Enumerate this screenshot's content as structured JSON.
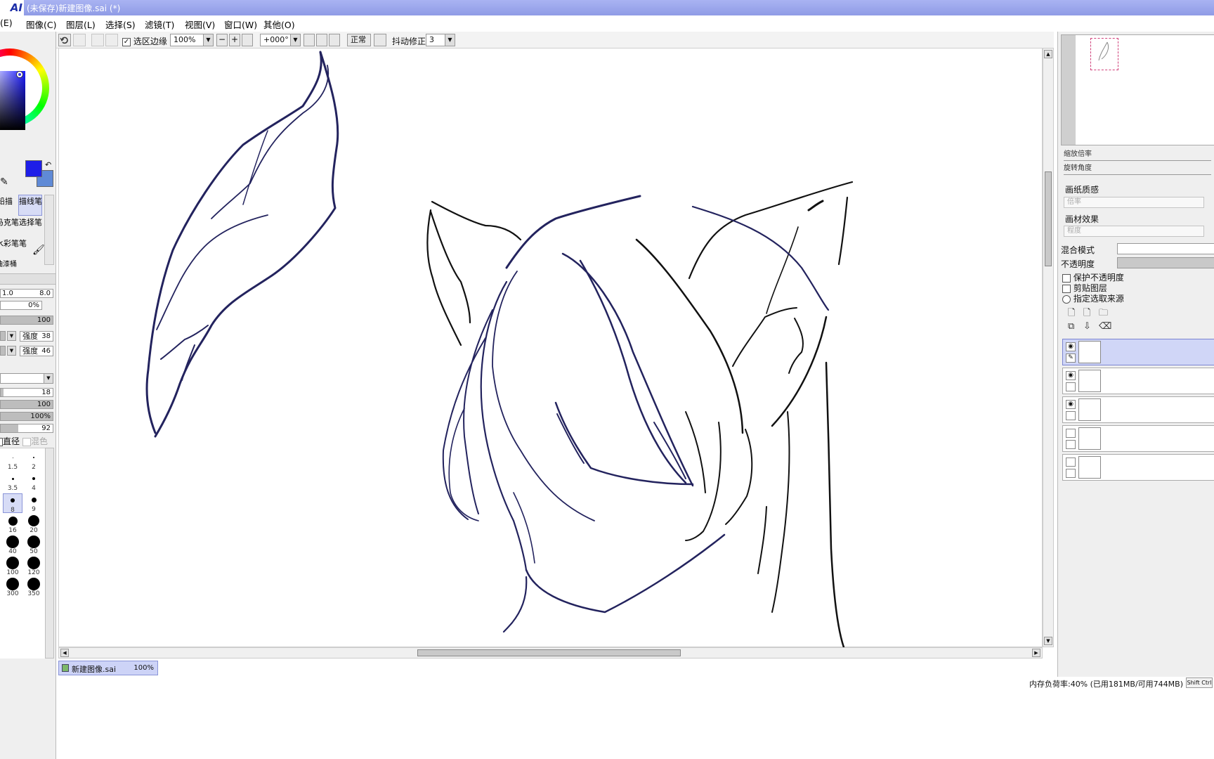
{
  "app": {
    "logo": "AI",
    "window_title": "(未保存)新建图像.sai (*)"
  },
  "menu": [
    {
      "label": "(E)"
    },
    {
      "label": "图像(C)"
    },
    {
      "label": "图层(L)"
    },
    {
      "label": "选择(S)"
    },
    {
      "label": "滤镜(T)"
    },
    {
      "label": "视图(V)"
    },
    {
      "label": "窗口(W)"
    },
    {
      "label": "其他(O)"
    }
  ],
  "toolbar": {
    "selection_edge_label": "选区边缘",
    "selection_edge_checked": true,
    "zoom_value": "100%",
    "rotation_value": "+000°",
    "blend_label": "正常",
    "stabilizer_label": "抖动修正",
    "stabilizer_value": "3"
  },
  "colors": {
    "primary": "#1e1ee8",
    "secondary": "#5f8ad6",
    "title_bar": "#9aa4ec",
    "line_color": "#23235e"
  },
  "tools": {
    "items": [
      "铅描",
      "描线笔",
      "马克笔",
      "选择笔",
      "水彩笔",
      "笔",
      "油漆桶"
    ],
    "selected": "描线笔"
  },
  "brush_settings": {
    "size_min": "1.0",
    "size_max": "8.0",
    "min_density": "0%",
    "density": "100",
    "shape_strength_label": "强度",
    "shape_strength": "38",
    "texture_strength_label": "强度",
    "texture_strength": "46",
    "blending": "18",
    "dilution": "100",
    "persistence": "100%",
    "smoothness": "92",
    "diameter_label": "直径",
    "mix_label": "混色"
  },
  "brush_sizes": [
    {
      "label": "1.5",
      "d": 1
    },
    {
      "label": "2",
      "d": 2
    },
    {
      "label": "3.5",
      "d": 3
    },
    {
      "label": "4",
      "d": 4
    },
    {
      "label": "8",
      "d": 6
    },
    {
      "label": "9",
      "d": 7
    },
    {
      "label": "16",
      "d": 13
    },
    {
      "label": "20",
      "d": 16
    },
    {
      "label": "40",
      "d": 18
    },
    {
      "label": "50",
      "d": 18
    },
    {
      "label": "100",
      "d": 18
    },
    {
      "label": "120",
      "d": 18
    },
    {
      "label": "300",
      "d": 18
    },
    {
      "label": "350",
      "d": 18
    }
  ],
  "selected_brush_size": "8",
  "right_panel": {
    "zoom_label": "缩放倍率",
    "rotate_label": "旋转角度",
    "paper_texture_label": "画纸质感",
    "paper_texture_field": "倍率",
    "paper_effect_label": "画材效果",
    "paper_effect_field": "程度",
    "blend_mode_label": "混合模式",
    "opacity_label": "不透明度",
    "protect_opacity_label": "保护不透明度",
    "clip_layer_label": "剪贴图层",
    "select_source_label": "指定选取来源"
  },
  "layers": [
    {
      "visible": true,
      "active": true
    },
    {
      "visible": true,
      "active": false
    },
    {
      "visible": true,
      "active": false
    },
    {
      "visible": false,
      "active": false
    },
    {
      "visible": false,
      "active": false
    }
  ],
  "document_tab": {
    "name": "新建图像.sai",
    "zoom": "100%"
  },
  "status": {
    "memory": "内存负荷率:40% (已用181MB/可用744MB)",
    "keys": "Shift Ctrl"
  }
}
